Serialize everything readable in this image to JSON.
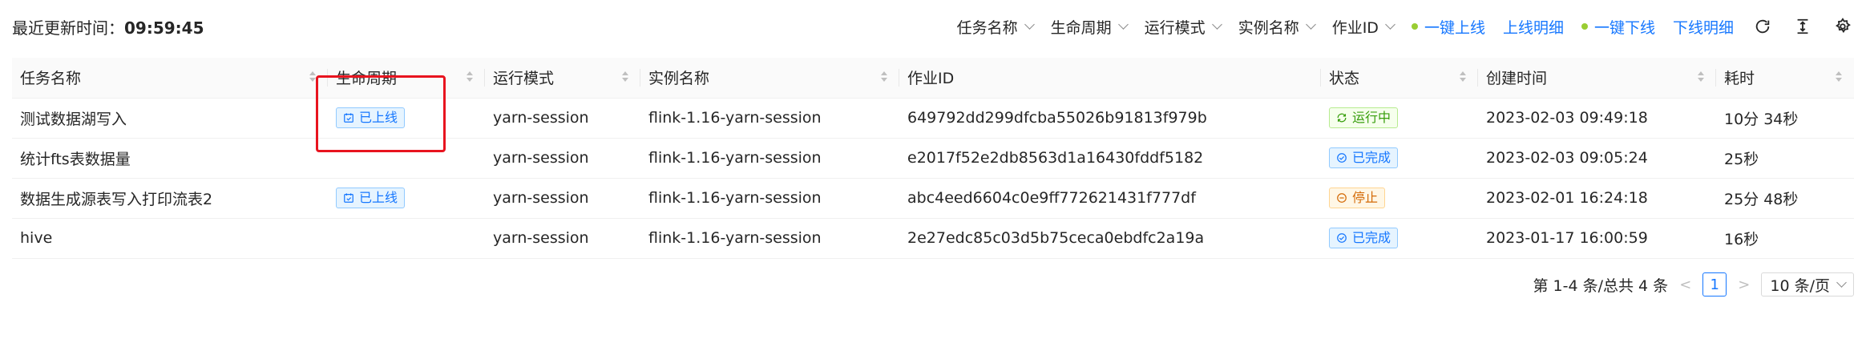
{
  "header": {
    "update_label": "最近更新时间：",
    "update_time": "09:59:45",
    "filters": [
      {
        "label": "任务名称"
      },
      {
        "label": "生命周期"
      },
      {
        "label": "运行模式"
      },
      {
        "label": "实例名称"
      },
      {
        "label": "作业ID"
      }
    ],
    "actions": {
      "online": "一键上线",
      "online_detail": "上线明细",
      "offline": "一键下线",
      "offline_detail": "下线明细"
    },
    "icons": [
      "refresh-icon",
      "column-height-icon",
      "settings-icon"
    ]
  },
  "table": {
    "columns": [
      "任务名称",
      "生命周期",
      "运行模式",
      "实例名称",
      "作业ID",
      "状态",
      "创建时间",
      "耗时"
    ],
    "rows": [
      {
        "name": "测试数据湖写入",
        "lifecycle": "已上线",
        "mode": "yarn-session",
        "instance": "flink-1.16-yarn-session",
        "job_id": "649792dd299dfcba55026b91813f979b",
        "status": "运行中",
        "status_type": "running",
        "created": "2023-02-03 09:49:18",
        "duration": "10分 34秒"
      },
      {
        "name": "统计fts表数据量",
        "lifecycle": "",
        "mode": "yarn-session",
        "instance": "flink-1.16-yarn-session",
        "job_id": "e2017f52e2db8563d1a16430fddf5182",
        "status": "已完成",
        "status_type": "finished",
        "created": "2023-02-03 09:05:24",
        "duration": "25秒"
      },
      {
        "name": "数据生成源表写入打印流表2",
        "lifecycle": "已上线",
        "mode": "yarn-session",
        "instance": "flink-1.16-yarn-session",
        "job_id": "abc4eed6604c0e9ff772621431f777df",
        "status": "停止",
        "status_type": "stopped",
        "created": "2023-02-01 16:24:18",
        "duration": "25分 48秒"
      },
      {
        "name": "hive",
        "lifecycle": "",
        "mode": "yarn-session",
        "instance": "flink-1.16-yarn-session",
        "job_id": "2e27edc85c03d5b75ceca0ebdfc2a19a",
        "status": "已完成",
        "status_type": "finished",
        "created": "2023-01-17 16:00:59",
        "duration": "16秒"
      }
    ]
  },
  "pagination": {
    "summary": "第 1-4 条/总共 4 条",
    "current": "1",
    "page_size": "10 条/页"
  },
  "colors": {
    "primary": "#1677ff",
    "running": "#389e0d",
    "stopped": "#d46b08",
    "highlight": "#e8141f"
  }
}
